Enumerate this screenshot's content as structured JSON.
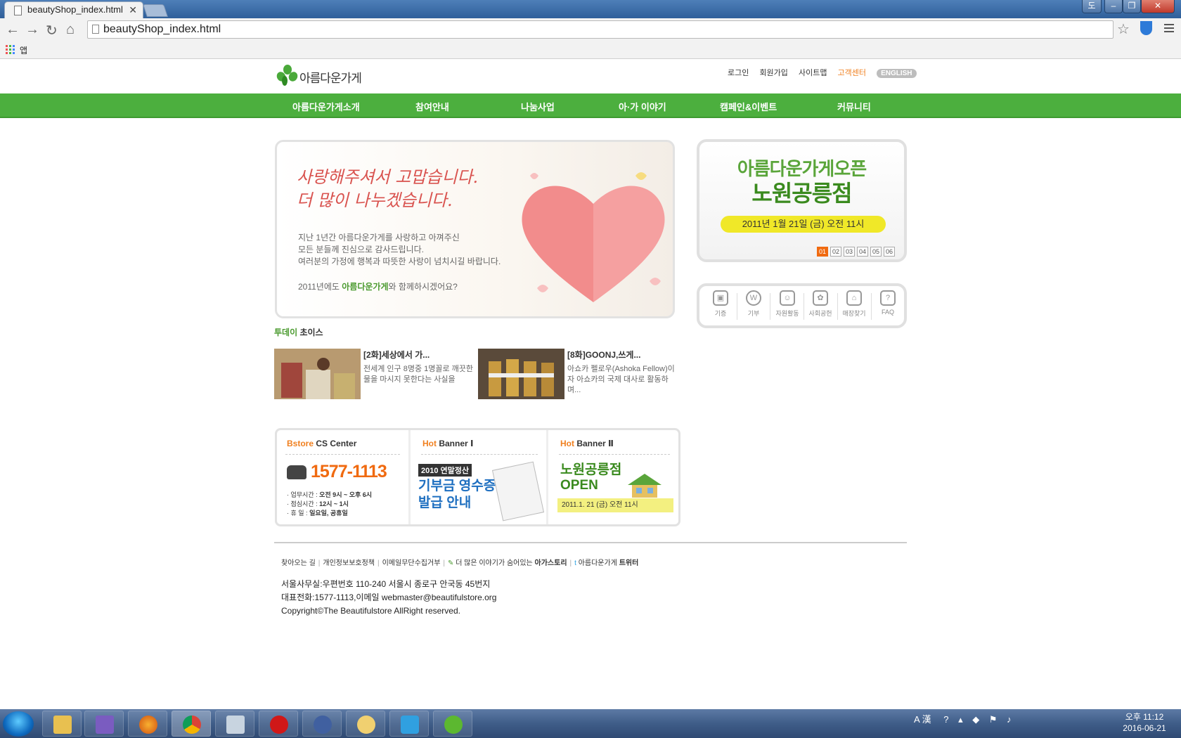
{
  "browser": {
    "tab_title": "beautyShop_index.html",
    "url": "beautyShop_index.html",
    "bookmark_apps": "앱",
    "user_button": "도"
  },
  "site": {
    "logo_text": "아름다운가게",
    "util_links": [
      "로그인",
      "회원가입",
      "사이트맵",
      "고객센터"
    ],
    "english_label": "ENGLISH",
    "gnb": [
      "아름다운가게소개",
      "참여안내",
      "나눔사업",
      "아·가 이야기",
      "캠페인&이벤트",
      "커뮤니티"
    ]
  },
  "main_banner": {
    "headline1": "사랑해주셔서 고맙습니다.",
    "headline2": "더 많이 나누겠습니다.",
    "body1": "지난 1년간 아름다운가게를 사랑하고 아껴주신",
    "body2": "모든 분들께 진심으로 감사드립니다.",
    "body3": "여러분의 가정에 행복과 따뜻한 사랑이 넘치시길 바랍니다.",
    "foot_prefix": "2011년에도 ",
    "foot_brand": "아름다운가게",
    "foot_suffix": "와 함께하시겠어요?"
  },
  "open_banner": {
    "line1": "아름다운가게오픈",
    "line2": "노원공릉점",
    "date": "2011년 1월 21일 (금) 오전 11시",
    "pages": [
      "01",
      "02",
      "03",
      "04",
      "05",
      "06"
    ],
    "active_page": "01"
  },
  "quick_menu": [
    {
      "label": "기증",
      "icon": "gift-icon"
    },
    {
      "label": "기부",
      "icon": "donation-icon"
    },
    {
      "label": "자원활동",
      "icon": "volunteer-icon"
    },
    {
      "label": "사회공헌",
      "icon": "social-icon"
    },
    {
      "label": "매장찾기",
      "icon": "store-icon"
    },
    {
      "label": "FAQ",
      "icon": "faq-icon"
    }
  ],
  "today_choice": {
    "title_green": "투데이",
    "title_rest": " 초이스",
    "items": [
      {
        "title": "[2화]세상에서 가...",
        "desc": "전세계 인구 8명중 1명꼴로 깨끗한 물을 마시지 못한다는 사실을"
      },
      {
        "title": "[8화]GOONJ,쓰게...",
        "desc": "아쇼카 펠로우(Ashoka Fellow)이자 아쇼카의 국제 대사로 활동하며..."
      }
    ]
  },
  "bottom_banners": {
    "cs_title_o": "Bstore",
    "cs_title_rest": " CS Center",
    "cs_phone": "1577-1113",
    "cs_hours": [
      {
        "label": "· 업무시간 : ",
        "value": "오전 9시 ~ 오후 6시"
      },
      {
        "label": "· 점심시간 : ",
        "value": "12시 ~ 1시"
      },
      {
        "label": "· 휴      일 : ",
        "value": "일요일, 공휴일"
      }
    ],
    "hb1_title_o": "Hot",
    "hb1_title_rest": " Banner Ⅰ",
    "hb1_tag": "2010 연말정산",
    "hb1_line1": "기부금 영수증",
    "hb1_line2": "발급 안내",
    "hb2_title_o": "Hot",
    "hb2_title_rest": " Banner Ⅱ",
    "hb2_line1": "노원공릉점",
    "hb2_line2": "OPEN",
    "hb2_date": "2011.1. 21 (금) 오전 11시"
  },
  "footer": {
    "links": [
      "찾아오는 길",
      "개인정보보호정책",
      "이메일무단수집거부"
    ],
    "story_prefix": "더 많은 이야기가 숨어있는 ",
    "story_bold": "아가스토리",
    "twitter_prefix": "아름다운가게 ",
    "twitter_bold": "트위터",
    "address": "서울사무실:우편번호 110-240 서울시 종로구 안국동 45번지",
    "phone": "대표전화:1577-1113,이메일 webmaster@beautifulstore.org",
    "copyright": "Copyright©The Beautifulstore AllRight reserved."
  },
  "taskbar": {
    "tray_text": "A 漢",
    "clock_time": "오후 11:12",
    "clock_date": "2016-06-21"
  }
}
